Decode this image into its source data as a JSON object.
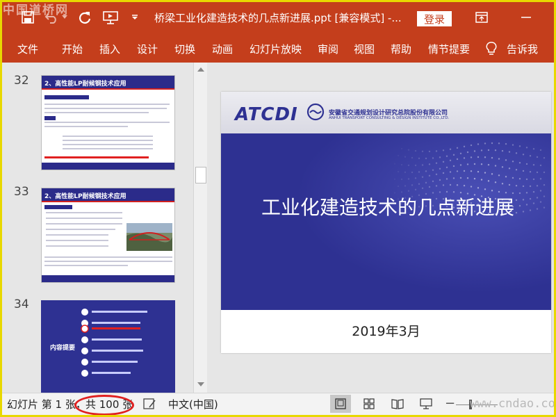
{
  "watermark_top_left": "中国道桥网",
  "watermark_bottom_right": "www.cndao.com",
  "titlebar": {
    "doc_title": "桥梁工业化建造技术的几点新进展.ppt [兼容模式]  -...",
    "login_label": "登录"
  },
  "ribbon": {
    "tabs": [
      "文件",
      "开始",
      "插入",
      "设计",
      "切换",
      "动画",
      "幻灯片放映",
      "审阅",
      "视图",
      "帮助",
      "情节提要",
      "告诉我"
    ]
  },
  "thumbnails": [
    {
      "number": "32",
      "title": "2、高性能LP耐候钢技术应用"
    },
    {
      "number": "33",
      "title": "2、高性能LP耐候钢技术应用"
    },
    {
      "number": "34",
      "title": "内容提要"
    }
  ],
  "main_slide": {
    "logo_text": "ATCDI",
    "company_cn": "安徽省交通规划设计研究总院股份有限公司",
    "company_en": "ANHUI TRANSPORT CONSULTING & DESIGN INSTITUTE CO.,LTD.",
    "heading": "工业化建造技术的几点新进展",
    "date": "2019年3月"
  },
  "statusbar": {
    "slide_label": "幻灯片 第 1 张，",
    "total_label": "共 100 张",
    "language": "中文(中国)"
  },
  "colors": {
    "ribbon": "#c43e1c",
    "slide_band": "#2e3192",
    "highlight_ellipse": "#e02020",
    "frame_border": "#e8d800"
  }
}
